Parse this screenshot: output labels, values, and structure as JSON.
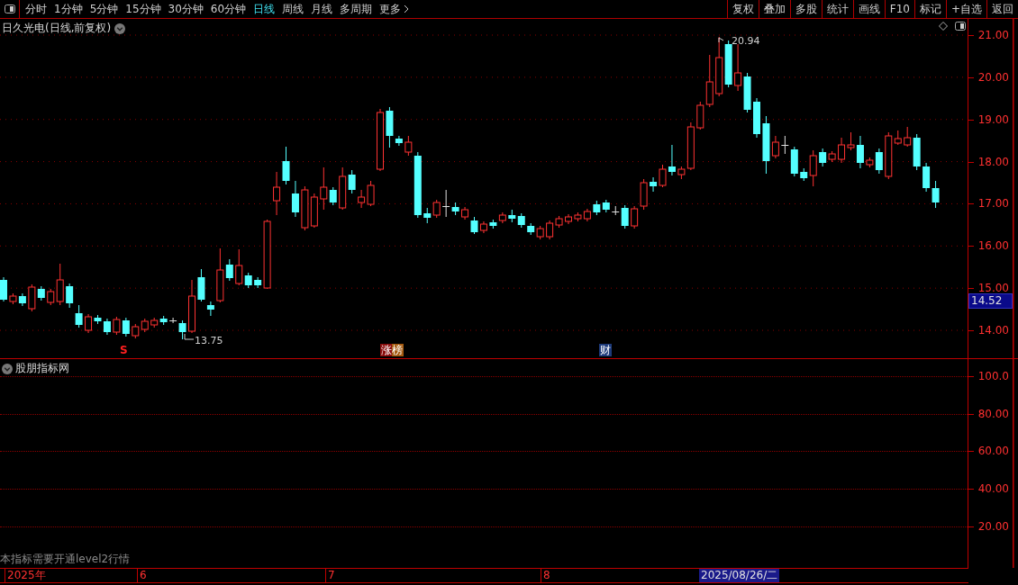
{
  "toolbar": {
    "tabs": [
      {
        "label": "分时",
        "selected": false
      },
      {
        "label": "1分钟",
        "selected": false
      },
      {
        "label": "5分钟",
        "selected": false
      },
      {
        "label": "15分钟",
        "selected": false
      },
      {
        "label": "30分钟",
        "selected": false
      },
      {
        "label": "60分钟",
        "selected": false
      },
      {
        "label": "日线",
        "selected": true
      },
      {
        "label": "周线",
        "selected": false
      },
      {
        "label": "月线",
        "selected": false
      },
      {
        "label": "多周期",
        "selected": false
      }
    ],
    "more": "更多",
    "buttons": [
      "复权",
      "叠加",
      "多股",
      "统计",
      "画线",
      "F10",
      "标记",
      "+自选",
      "返回"
    ]
  },
  "main_chart": {
    "title": "日久光电(日线,前复权)",
    "price_labels": [
      "21.00",
      "20.00",
      "19.00",
      "18.00",
      "17.00",
      "16.00",
      "15.00",
      "14.00"
    ],
    "current_price": "14.52",
    "high_marker": "20.94",
    "low_marker": "13.75",
    "event_markers": [
      {
        "label": "S",
        "kind": "signal"
      },
      {
        "label": "涨榜",
        "kind": "limit"
      },
      {
        "label": "财",
        "kind": "finance"
      }
    ]
  },
  "indicator": {
    "title": "股朋指标网",
    "labels": [
      "100.0",
      "80.00",
      "60.00",
      "40.00",
      "20.00"
    ],
    "notice": "本指标需要开通level2行情"
  },
  "date_axis": {
    "labels": [
      "2025年",
      "6",
      "7",
      "8"
    ],
    "cursor_date": "2025/08/26/二"
  }
}
